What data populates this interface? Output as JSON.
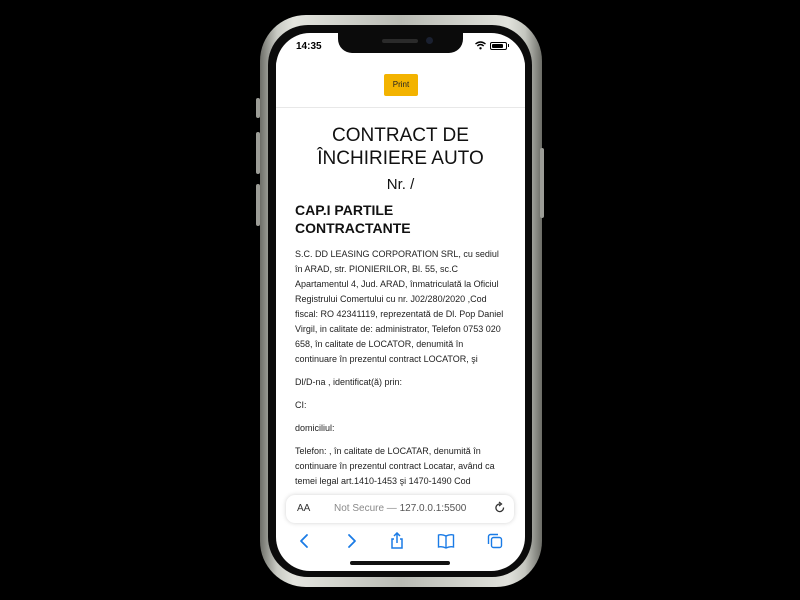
{
  "status_bar": {
    "time": "14:35"
  },
  "toolbar_print": {
    "label": "Print"
  },
  "document": {
    "title": "CONTRACT DE ÎNCHIRIERE AUTO",
    "number": "Nr. /",
    "chapter": "CAP.I PARTILE CONTRACTANTE",
    "paragraphs": [
      "S.C. DD LEASING CORPORATION SRL, cu sediul în ARAD, str. PIONIERILOR, Bl. 55, sc.C Apartamentul 4, Jud. ARAD, înmatriculată la Oficiul Registrului Comertului cu nr. J02/280/2020 ,Cod fiscal: RO 42341119, reprezentată de Dl. Pop Daniel Virgil, in calitate de: administrator, Telefon 0753 020 658, în calitate de LOCATOR, denumită în continuare în prezentul contract LOCATOR, şi",
      "Dl/D-na , identificat(ă) prin:",
      "CI:",
      "domiciliul:",
      "Telefon: , în calitate de LOCATAR, denumită în continuare în prezentul contract Locatar, având ca temei legal art.1410-1453 şi 1470-1490 Cod"
    ]
  },
  "browser": {
    "text_size_label": "AA",
    "security_label": "Not Secure —",
    "url": "127.0.0.1:5500"
  },
  "colors": {
    "print_button": "#f3b300",
    "toolbar_icons": "#1a7be6"
  }
}
